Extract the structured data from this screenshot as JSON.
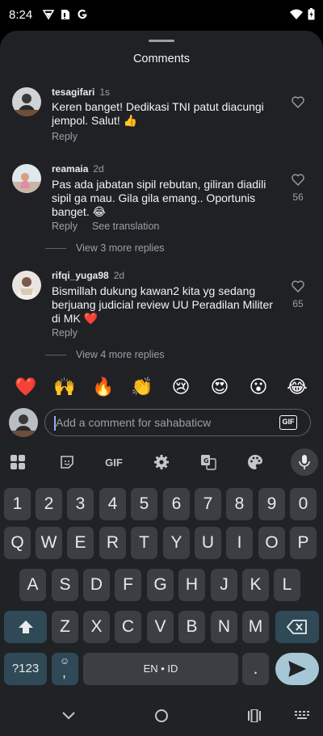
{
  "status_bar": {
    "time": "8:24",
    "left_icons": [
      "vpn-icon",
      "sim-icon",
      "google-icon"
    ],
    "right_icons": [
      "wifi-icon",
      "battery-icon"
    ]
  },
  "sheet": {
    "title": "Comments"
  },
  "comments": [
    {
      "username": "tesagifari",
      "time": "1s",
      "text": "Keren banget! Dedikasi TNI patut diacungi jempol. Salut! 👍",
      "reply_label": "Reply",
      "likes": ""
    },
    {
      "username": "reamaia",
      "time": "2d",
      "text": "Pas ada jabatan sipil rebutan, giliran diadili sipil ga mau. Gila gila emang.. Oportunis banget. 😂",
      "reply_label": "Reply",
      "translate_label": "See translation",
      "likes": "56",
      "more_replies": "View 3 more replies"
    },
    {
      "username": "rifqi_yuga98",
      "time": "2d",
      "text": "Bismillah dukung kawan2 kita yg sedang berjuang judicial review UU Peradilan Militer di MK ❤️",
      "reply_label": "Reply",
      "likes": "65",
      "more_replies": "View 4 more replies"
    }
  ],
  "reactions": [
    "❤️",
    "🙌",
    "🔥",
    "👏",
    "😢",
    "😍",
    "😮",
    "😂"
  ],
  "comment_input": {
    "placeholder": "Add a comment for sahabaticw",
    "gif_label": "GIF"
  },
  "keyboard": {
    "toolbar": {
      "gif_label": "GIF",
      "icons": [
        "apps-grid-icon",
        "sticker-icon",
        "gif-icon",
        "settings-icon",
        "translate-icon",
        "palette-icon",
        "mic-icon"
      ]
    },
    "row_numbers": [
      "1",
      "2",
      "3",
      "4",
      "5",
      "6",
      "7",
      "8",
      "9",
      "0"
    ],
    "row_1": [
      "Q",
      "W",
      "E",
      "R",
      "T",
      "Y",
      "U",
      "I",
      "O",
      "P"
    ],
    "row_2": [
      "A",
      "S",
      "D",
      "F",
      "G",
      "H",
      "J",
      "K",
      "L"
    ],
    "row_3": [
      "Z",
      "X",
      "C",
      "V",
      "B",
      "N",
      "M"
    ],
    "symbols_label": "?123",
    "comma_label": ",",
    "space_label": "EN • ID",
    "period_label": "."
  },
  "navbar": {
    "icons": [
      "back-chevron-icon",
      "home-circle-icon",
      "recents-icon",
      "keyboard-switch-icon"
    ]
  }
}
